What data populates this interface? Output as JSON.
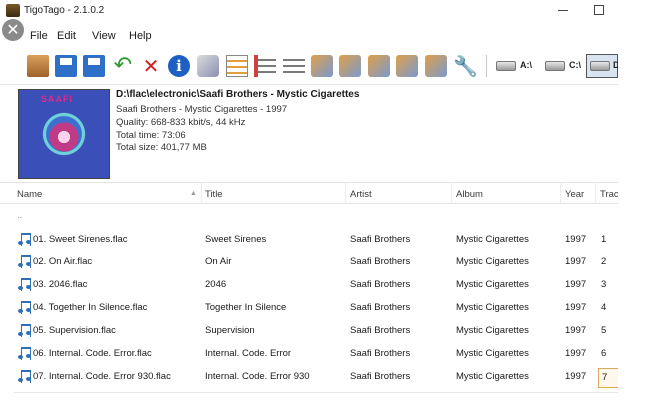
{
  "window": {
    "title": "TigoTago - 2.1.0.2"
  },
  "menu": {
    "items": [
      "File",
      "Edit",
      "View",
      "Help"
    ]
  },
  "toolbar": {
    "drives": [
      "A:\\",
      "C:\\",
      "D"
    ]
  },
  "info": {
    "path": "D:\\flac\\electronic\\Saafi Brothers - Mystic Cigarettes",
    "album_line": "Saafi Brothers - Mystic Cigarettes - 1997",
    "quality": "Quality: 668-833 kbit/s, 44 kHz",
    "total_time": "Total time: 73:06",
    "total_size": "Total size: 401,77 MB",
    "cover_text": "SAAFI"
  },
  "table": {
    "columns": [
      "Name",
      "Title",
      "Artist",
      "Album",
      "Year",
      "Track"
    ],
    "parent_row": "..",
    "rows": [
      {
        "name": "01. Sweet Sirenes.flac",
        "title": "Sweet Sirenes",
        "artist": "Saafi Brothers",
        "album": "Mystic Cigarettes",
        "year": "1997",
        "track": "1"
      },
      {
        "name": "02. On Air.flac",
        "title": "On Air",
        "artist": "Saafi Brothers",
        "album": "Mystic Cigarettes",
        "year": "1997",
        "track": "2"
      },
      {
        "name": "03. 2046.flac",
        "title": "2046",
        "artist": "Saafi Brothers",
        "album": "Mystic Cigarettes",
        "year": "1997",
        "track": "3"
      },
      {
        "name": "04. Together In Silence.flac",
        "title": "Together In Silence",
        "artist": "Saafi Brothers",
        "album": "Mystic Cigarettes",
        "year": "1997",
        "track": "4"
      },
      {
        "name": "05. Supervision.flac",
        "title": "Supervision",
        "artist": "Saafi Brothers",
        "album": "Mystic Cigarettes",
        "year": "1997",
        "track": "5"
      },
      {
        "name": "06. Internal. Code. Error.flac",
        "title": "Internal. Code. Error",
        "artist": "Saafi Brothers",
        "album": "Mystic Cigarettes",
        "year": "1997",
        "track": "6"
      },
      {
        "name": "07. Internal. Code. Error 930.flac",
        "title": "Internal. Code. Error 930",
        "artist": "Saafi Brothers",
        "album": "Mystic Cigarettes",
        "year": "1997",
        "track": "7"
      }
    ]
  },
  "colors": {
    "accent": "#2f6fb5",
    "selection_border": "#d9a85a",
    "brand": "#e02a8a"
  },
  "icons": [
    "folder-open-icon",
    "save-icon",
    "save-all-icon",
    "undo-icon",
    "delete-icon",
    "info-icon",
    "edit-tags-icon",
    "list-icon",
    "numbered-list-icon",
    "bullet-list-icon",
    "tag-icon",
    "settings-wrench-icon",
    "drive-icon",
    "music-note-icon"
  ]
}
